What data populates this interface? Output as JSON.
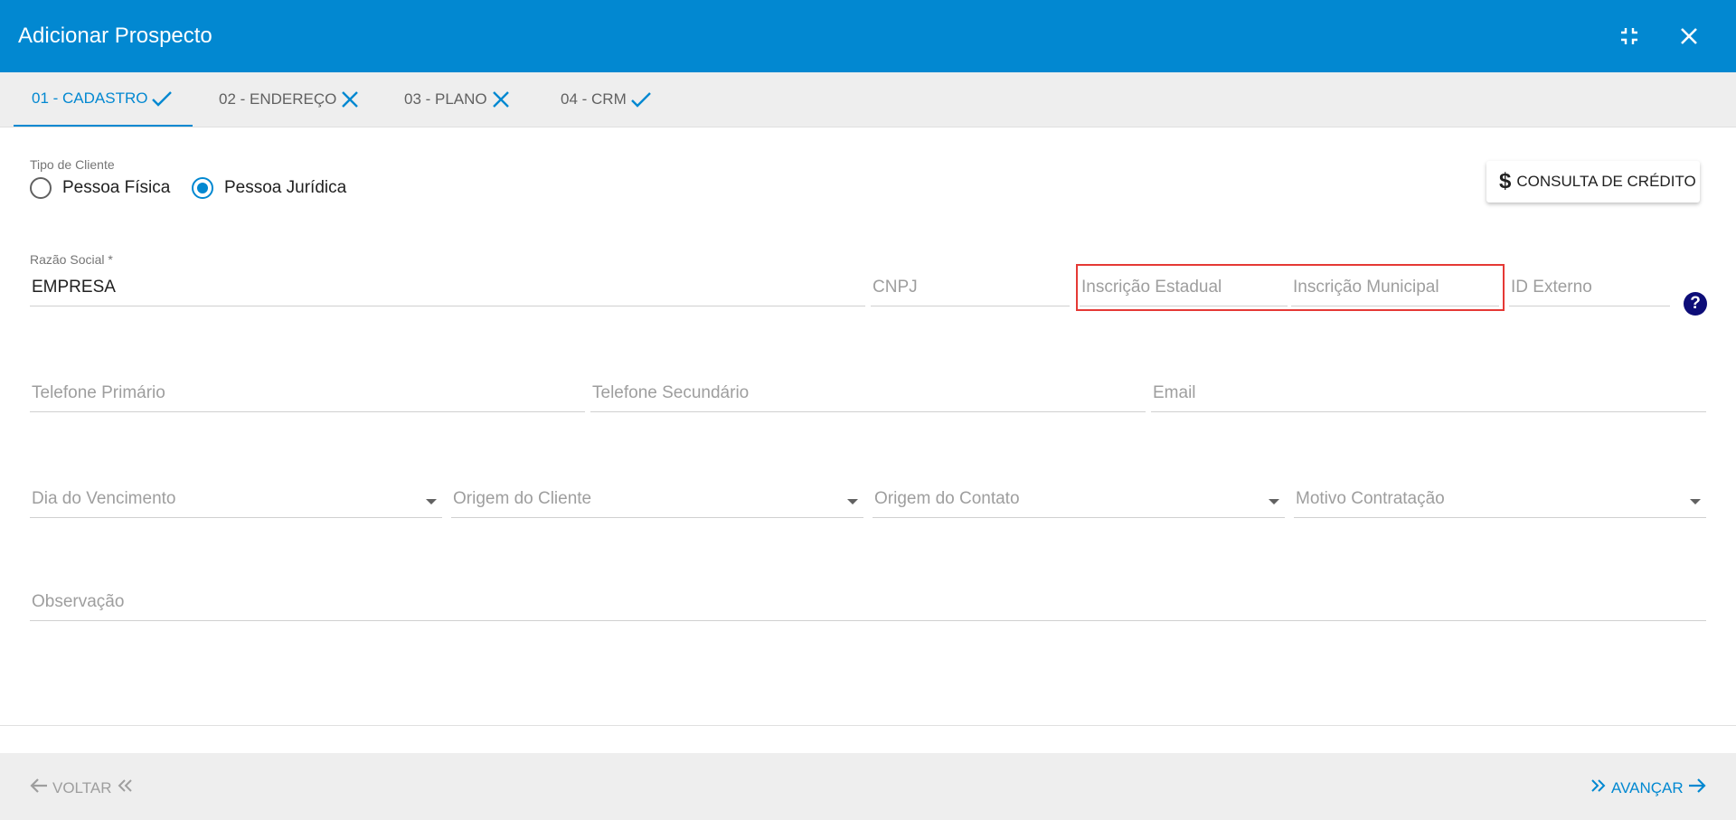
{
  "header": {
    "title": "Adicionar Prospecto"
  },
  "tabs": [
    {
      "label": "01 - CADASTRO",
      "status_icon": "check-icon"
    },
    {
      "label": "02 - ENDEREÇO",
      "status_icon": "close-icon"
    },
    {
      "label": "03 - PLANO",
      "status_icon": "close-icon"
    },
    {
      "label": "04 - CRM",
      "status_icon": "check-icon"
    }
  ],
  "client_type": {
    "label": "Tipo de Cliente",
    "options": [
      "Pessoa Física",
      "Pessoa Jurídica"
    ],
    "selected": "Pessoa Jurídica"
  },
  "credit_button": {
    "label": "CONSULTA DE CRÉDITO",
    "icon": "dollar-icon"
  },
  "form": {
    "razao_social": {
      "label": "Razão Social *",
      "value": "EMPRESA"
    },
    "cnpj": {
      "placeholder": "CNPJ"
    },
    "inscricao_estadual": {
      "placeholder": "Inscrição Estadual"
    },
    "inscricao_municipal": {
      "placeholder": "Inscrição Municipal"
    },
    "id_externo": {
      "placeholder": "ID Externo"
    },
    "telefone_primario": {
      "placeholder": "Telefone Primário"
    },
    "telefone_secundario": {
      "placeholder": "Telefone Secundário"
    },
    "email": {
      "placeholder": "Email"
    },
    "dia_vencimento": {
      "placeholder": "Dia do Vencimento"
    },
    "origem_cliente": {
      "placeholder": "Origem do Cliente"
    },
    "origem_contato": {
      "placeholder": "Origem do Contato"
    },
    "motivo_contratacao": {
      "placeholder": "Motivo Contratação"
    },
    "observacao": {
      "placeholder": "Observação"
    }
  },
  "help_icon": {
    "label": "?"
  },
  "footer": {
    "back_label": "VOLTAR",
    "next_label": "AVANÇAR"
  },
  "colors": {
    "primary": "#0288d1",
    "highlight": "#e53935",
    "help": "#0d0d78"
  }
}
